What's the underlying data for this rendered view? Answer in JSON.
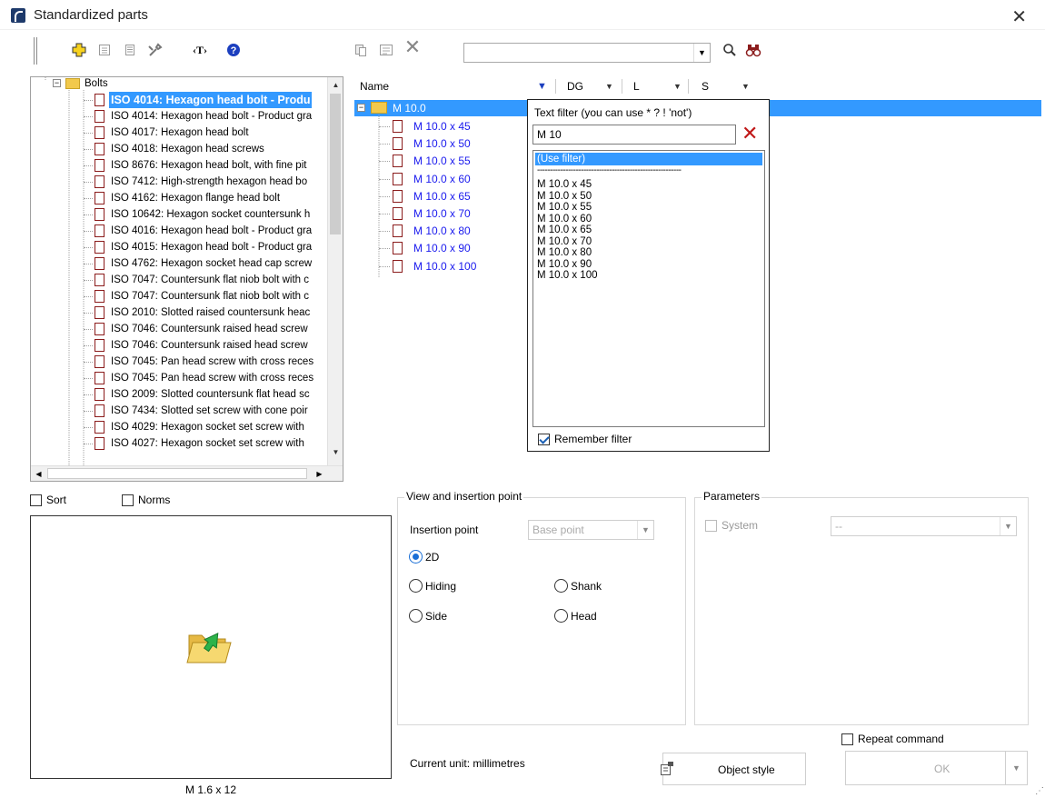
{
  "window": {
    "title": "Standardized parts",
    "close_symbol": "✕"
  },
  "toolbar": {
    "search_value": "",
    "icons": [
      "add-icon",
      "copy-icon",
      "properties-icon",
      "tools-icon",
      "text-icon",
      "help-icon",
      "paste-icon",
      "table-icon",
      "delete-icon",
      "search-icon",
      "binoculars-icon"
    ]
  },
  "tree": {
    "root_label": "Bolts",
    "selected_index": 0,
    "items": [
      "ISO 4014: Hexagon head bolt - Produ",
      "ISO 4014: Hexagon head bolt - Product gra",
      "ISO 4017: Hexagon head bolt",
      "ISO 4018: Hexagon head screws",
      "ISO 8676: Hexagon head bolt, with fine pit",
      "ISO 7412: High-strength hexagon head bo",
      "ISO 4162: Hexagon flange head bolt",
      "ISO 10642: Hexagon socket countersunk h",
      "ISO 4016: Hexagon head bolt - Product gra",
      "ISO 4015: Hexagon head bolt - Product gra",
      "ISO 4762: Hexagon socket head cap screw",
      "ISO 7047: Countersunk flat niob bolt with c",
      "ISO 7047: Countersunk flat niob bolt with c",
      "ISO 2010: Slotted raised countersunk heac",
      "ISO 7046: Countersunk raised head screw",
      "ISO 7046: Countersunk raised head screw",
      "ISO 7045: Pan head screw with cross reces",
      "ISO 7045: Pan head screw with cross reces",
      "ISO 2009: Slotted countersunk flat head sc",
      "ISO 7434: Slotted set screw with cone poir",
      "ISO 4029: Hexagon socket set screw with",
      "ISO 4027: Hexagon socket set screw with"
    ]
  },
  "options": {
    "sort_label": "Sort",
    "norms_label": "Norms",
    "sort_checked": false,
    "norms_checked": false
  },
  "preview": {
    "caption": "M 1.6 x 12"
  },
  "grid": {
    "columns": [
      "Name",
      "DG",
      "L",
      "S"
    ],
    "group_label": "M 10.0",
    "items": [
      "M 10.0 x 45",
      "M 10.0 x 50",
      "M 10.0 x 55",
      "M 10.0 x 60",
      "M 10.0 x 65",
      "M 10.0 x 70",
      "M 10.0 x 80",
      "M 10.0 x 90",
      "M 10.0 x 100"
    ]
  },
  "filter": {
    "label": "Text filter (you can use * ? ! 'not')",
    "value": "M 10",
    "use_filter_label": "(Use filter)",
    "separator": "--------------------------------------------------------",
    "options": [
      "M 10.0 x 45",
      "M 10.0 x 50",
      "M 10.0 x 55",
      "M 10.0 x 60",
      "M 10.0 x 65",
      "M 10.0 x 70",
      "M 10.0 x 80",
      "M 10.0 x 90",
      "M 10.0 x 100"
    ],
    "remember_label": "Remember filter",
    "remember_checked": true
  },
  "view": {
    "title": "View and insertion point",
    "insertion_label": "Insertion point",
    "insertion_value": "Base point",
    "radios": {
      "r2d": "2D",
      "hiding": "Hiding",
      "shank": "Shank",
      "side": "Side",
      "head": "Head"
    },
    "selected": "2D"
  },
  "parameters": {
    "title": "Parameters",
    "system_label": "System",
    "system_value": "--"
  },
  "footer": {
    "repeat_label": "Repeat command",
    "repeat_checked": false,
    "unit_text": "Current unit: millimetres",
    "object_style_label": "Object style",
    "ok_label": "OK"
  },
  "colors": {
    "selection": "#3399ff",
    "grid_text": "#1a1aee",
    "doc_icon": "#8b1c1c",
    "folder": "#f2c94c",
    "help": "#1c3fbf"
  }
}
